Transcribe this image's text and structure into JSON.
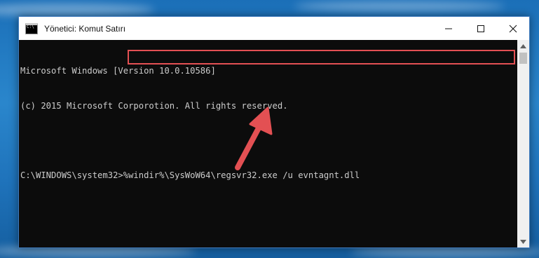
{
  "window": {
    "title": "Yönetici: Komut Satırı",
    "icon": "cmd-icon"
  },
  "caption_buttons": {
    "minimize": "minimize-icon",
    "maximize": "maximize-icon",
    "close": "close-icon"
  },
  "console": {
    "lines": [
      "Microsoft Windows [Version 10.0.10586]",
      "(c) 2015 Microsoft Corporotion. All rights reserved."
    ],
    "prompt": "C:\\WINDOWS\\system32>",
    "command": "%windir%\\SysWoW64\\regsvr32.exe /u evntagnt.dll"
  },
  "colors": {
    "console_bg": "#0c0c0c",
    "console_text": "#cccccc",
    "highlight": "#e35053",
    "annotation_arrow": "#e35053"
  }
}
